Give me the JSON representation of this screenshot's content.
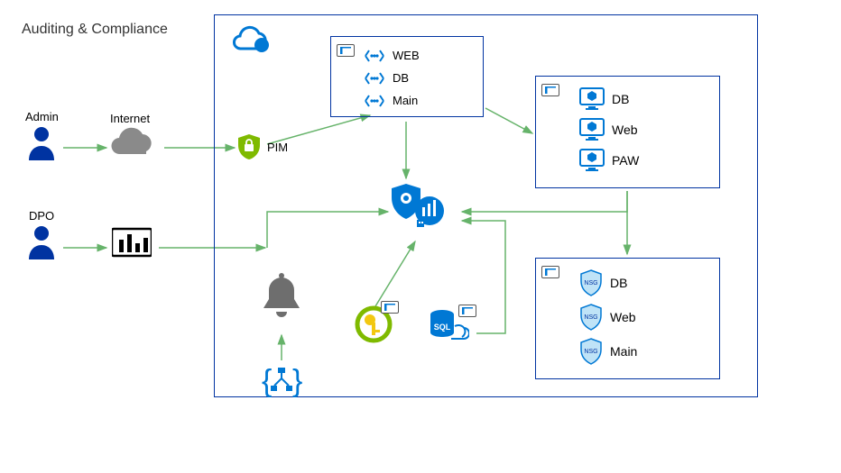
{
  "title": "Auditing & Compliance",
  "external": {
    "admin": {
      "label": "Admin"
    },
    "dpo": {
      "label": "DPO"
    },
    "internet": {
      "label": "Internet"
    },
    "powerbi": {
      "label": ""
    }
  },
  "cloud": {
    "pim": {
      "label": "PIM"
    },
    "gateway_group": {
      "items": [
        {
          "label": "WEB"
        },
        {
          "label": "DB"
        },
        {
          "label": "Main"
        }
      ]
    },
    "vm_group": {
      "items": [
        {
          "label": "DB"
        },
        {
          "label": "Web"
        },
        {
          "label": "PAW"
        }
      ]
    },
    "nsg_group": {
      "items": [
        {
          "label": "DB"
        },
        {
          "label": "Web"
        },
        {
          "label": "Main"
        }
      ]
    },
    "security_center": {
      "label": ""
    },
    "keyvault": {
      "label": ""
    },
    "sql": {
      "label": "SQL"
    },
    "bell": {
      "label": ""
    },
    "logicapp": {
      "label": ""
    }
  },
  "colors": {
    "azure_blue": "#0078d4",
    "navy": "#0033a1",
    "green": "#7fba00",
    "arrow": "#66b36a",
    "gray": "#6e6e6e"
  }
}
